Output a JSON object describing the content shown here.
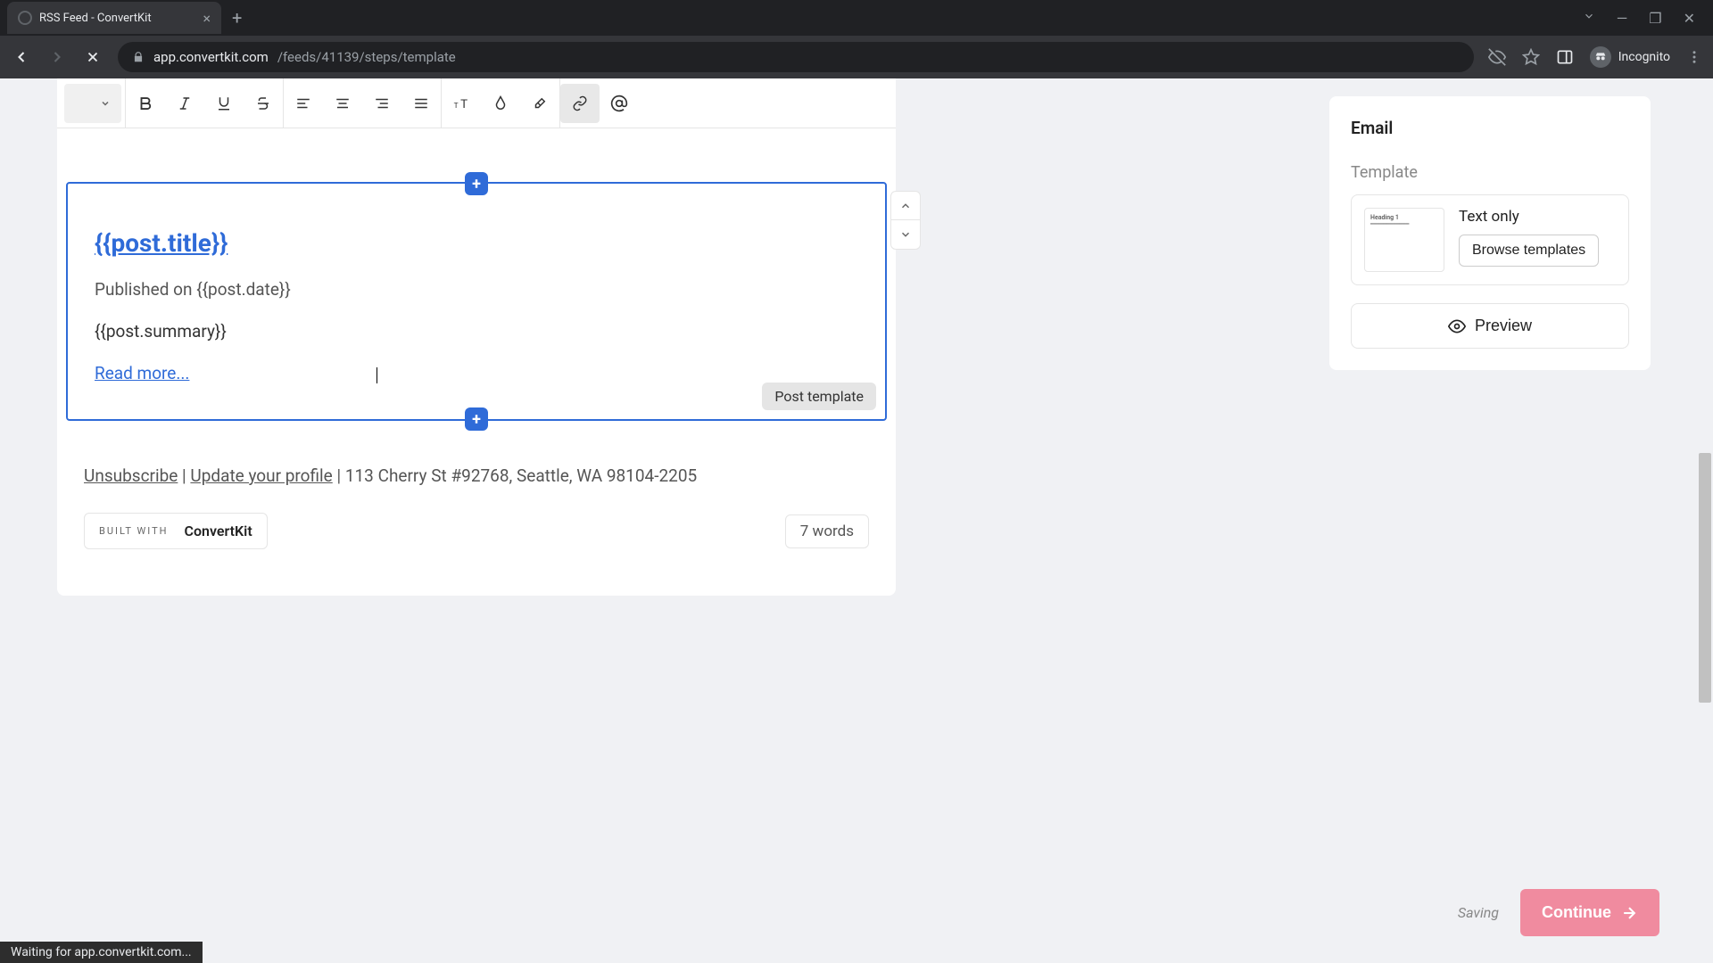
{
  "browser": {
    "tab_title": "RSS Feed - ConvertKit",
    "url_domain": "app.convertkit.com",
    "url_path": "/feeds/41139/steps/template",
    "incognito_label": "Incognito",
    "status_text": "Waiting for app.convertkit.com..."
  },
  "editor": {
    "post_title": "{{post.title}}",
    "published_prefix": "Published on ",
    "post_date": "{{post.date}}",
    "post_summary": "{{post.summary}}",
    "read_more": "Read more...",
    "block_label": "Post template"
  },
  "footer": {
    "unsubscribe": "Unsubscribe",
    "update_profile": "Update your profile",
    "address": "113 Cherry St #92768, Seattle, WA 98104-2205",
    "built_with": "BUILT WITH",
    "brand": "ConvertKit",
    "word_count": "7 words"
  },
  "sidebar": {
    "title": "Email",
    "template_label": "Template",
    "template_name": "Text only",
    "browse_label": "Browse templates",
    "preview_label": "Preview"
  },
  "bottom": {
    "saving": "Saving",
    "continue": "Continue"
  }
}
